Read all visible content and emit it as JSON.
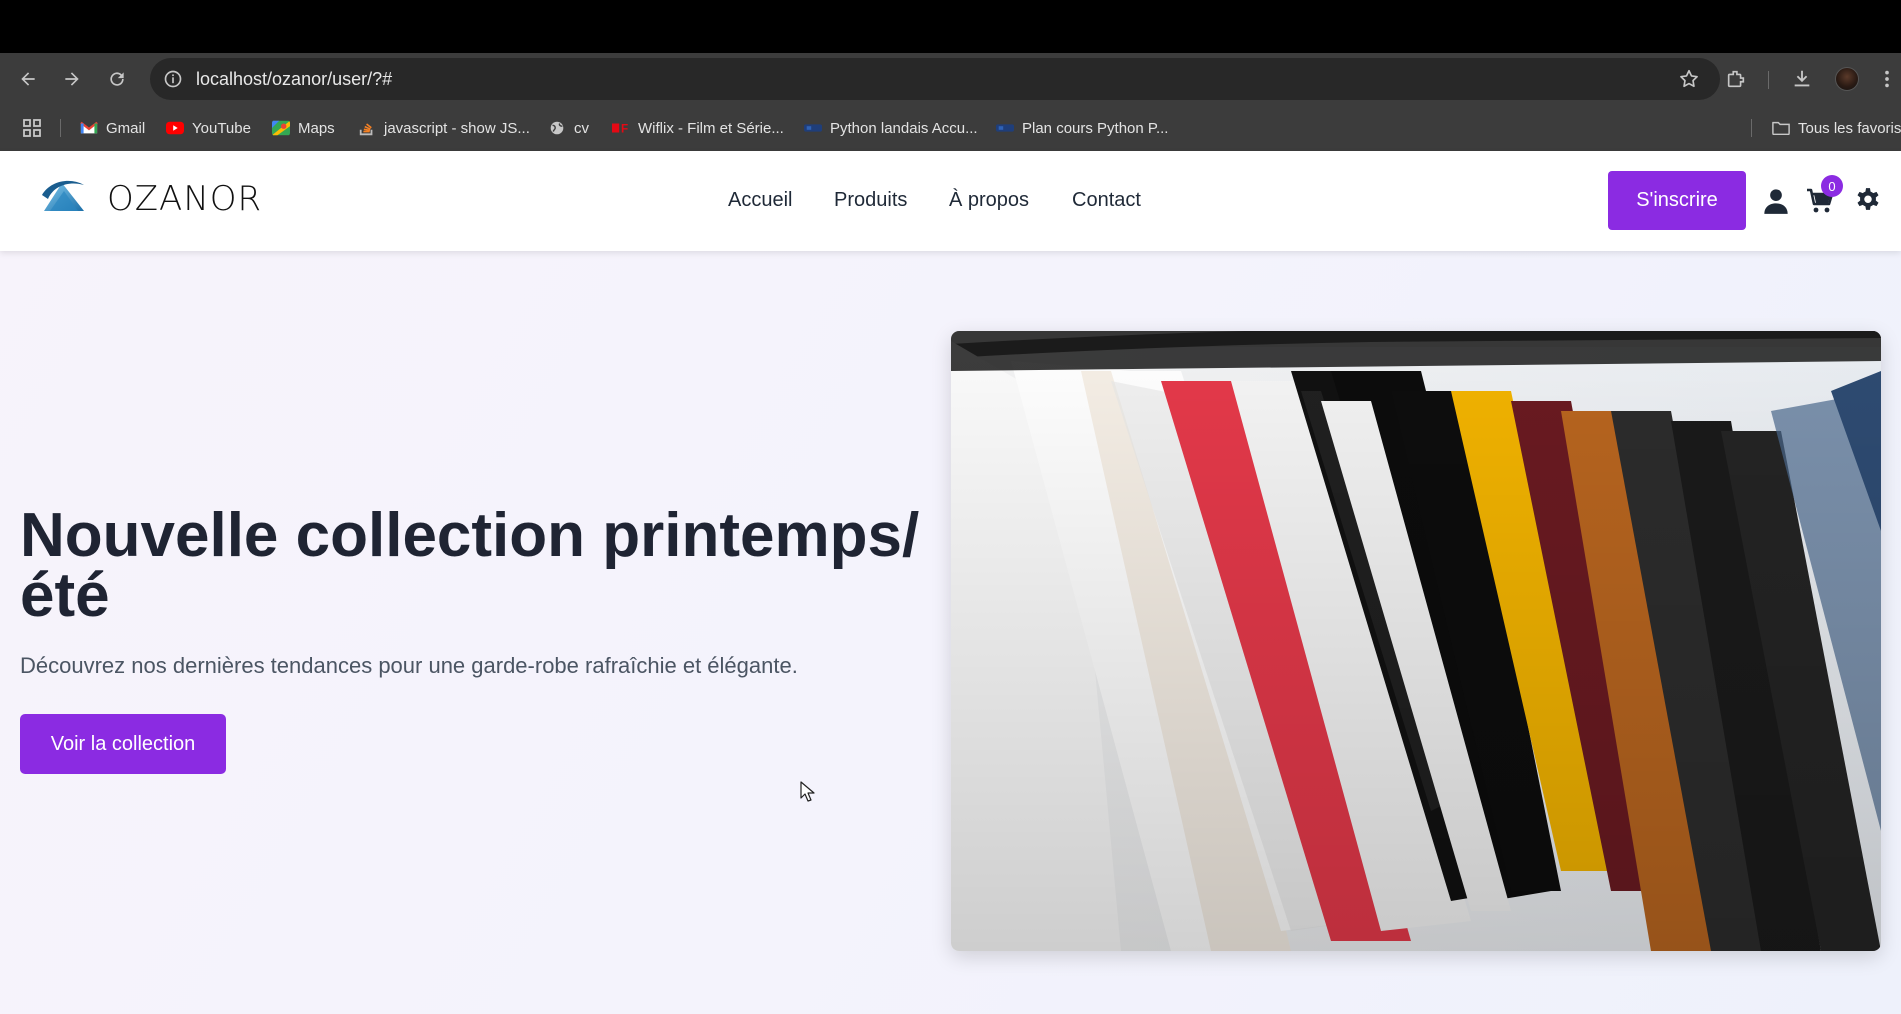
{
  "browser": {
    "url": "localhost/ozanor/user/?#",
    "bookmarks": [
      {
        "label": "Gmail",
        "icon": "gmail-icon"
      },
      {
        "label": "YouTube",
        "icon": "youtube-icon"
      },
      {
        "label": "Maps",
        "icon": "maps-icon"
      },
      {
        "label": "javascript - show JS...",
        "icon": "stackoverflow-icon"
      },
      {
        "label": "cv",
        "icon": "globe-icon"
      },
      {
        "label": "Wiflix - Film et Série...",
        "icon": "wiflix-icon"
      },
      {
        "label": "Python landais Accu...",
        "icon": "python-icon"
      },
      {
        "label": "Plan cours Python P...",
        "icon": "python-icon"
      }
    ],
    "all_bookmarks_label": "Tous les favoris"
  },
  "site": {
    "brand": "OZANOR",
    "nav": [
      "Accueil",
      "Produits",
      "À propos",
      "Contact"
    ],
    "signup_label": "S'inscrire",
    "cart_count": "0"
  },
  "hero": {
    "title": "Nouvelle collection printemps/ été",
    "subtitle": "Découvrez nos dernières tendances pour une garde-robe rafraîchie et élégante.",
    "cta_label": "Voir la collection"
  },
  "colors": {
    "accent": "#8b2be2",
    "heading": "#1f2433"
  }
}
